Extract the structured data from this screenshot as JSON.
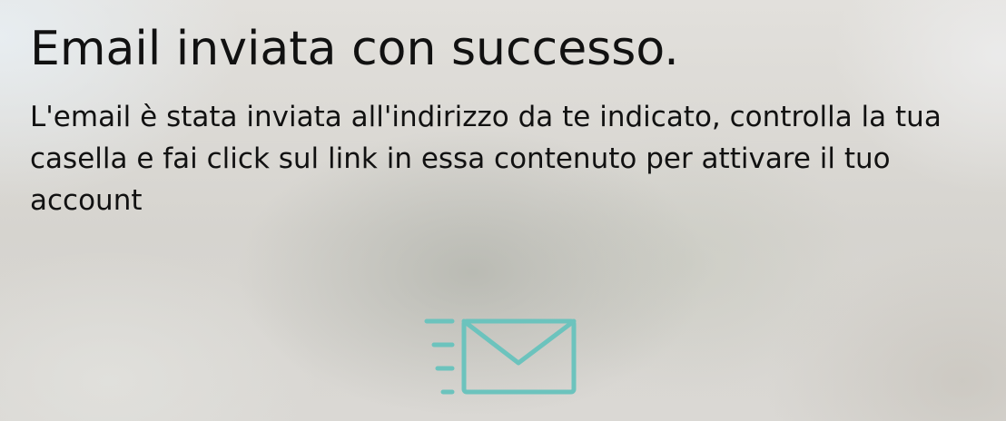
{
  "dialog": {
    "title": "Email inviata con successo.",
    "message": "L'email è stata inviata all'indirizzo da te indicato, controlla la tua casella e fai click sul link in essa contenuto per attivare il tuo account",
    "icon": "sent-envelope-icon",
    "accent_color": "#6cc3bd"
  }
}
